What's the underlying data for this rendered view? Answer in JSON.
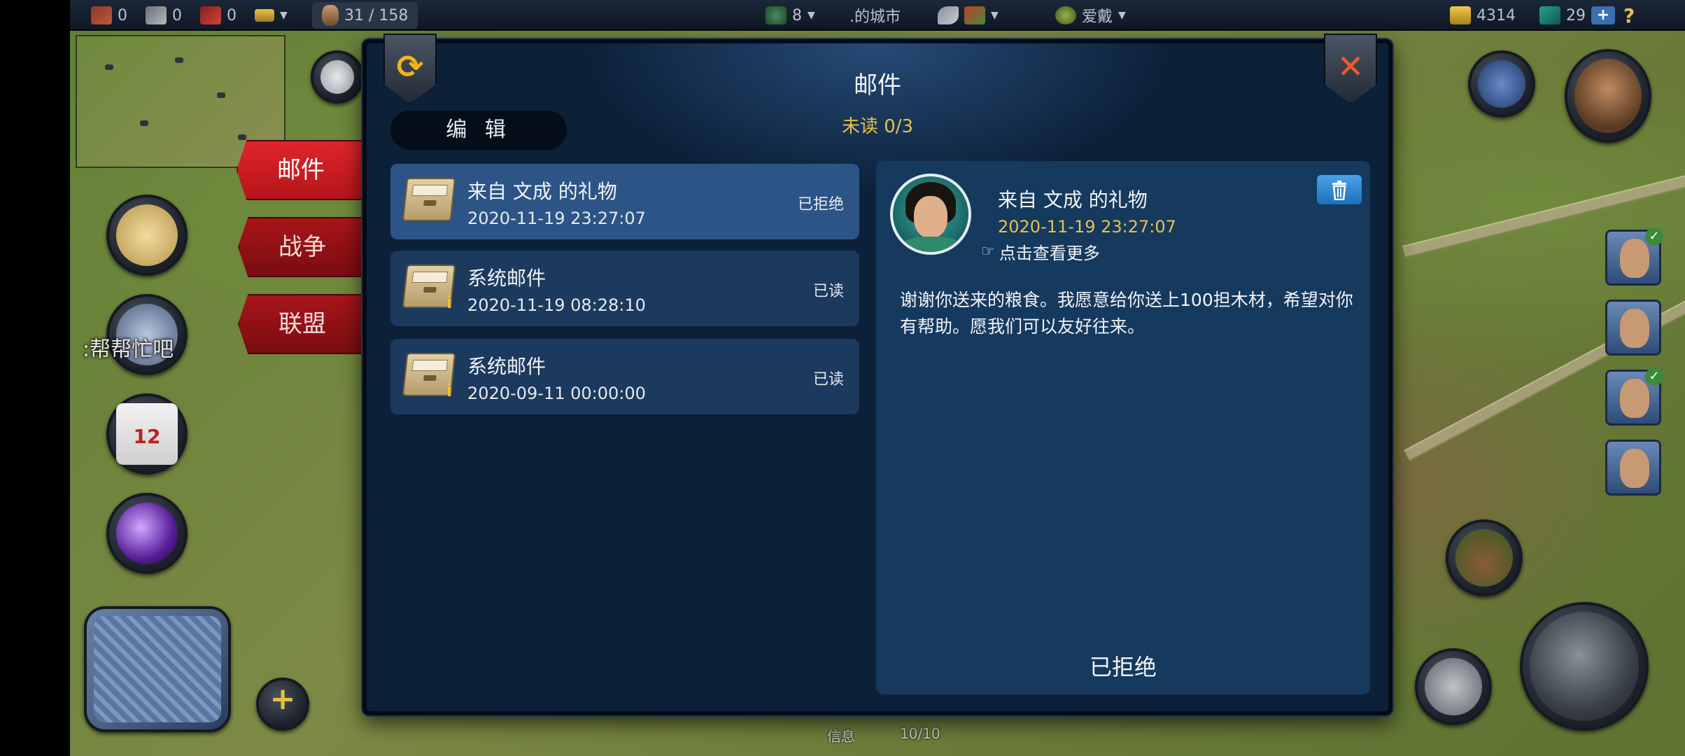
{
  "topbar": {
    "wood": "0",
    "stone": "0",
    "brick": "0",
    "population": "31 / 158",
    "herb_count": "8",
    "city_name": ".的城市",
    "ruler_name": "爱戴",
    "gold": "4314",
    "gems": "29",
    "plus": "+",
    "help": "?"
  },
  "left_hud": {
    "help_label": ":帮帮忙吧",
    "calendar_day": "12",
    "add": "+"
  },
  "side_tabs": [
    {
      "label": "邮件",
      "active": true
    },
    {
      "label": "战争",
      "active": false
    },
    {
      "label": "联盟",
      "active": false
    }
  ],
  "dialog": {
    "title": "邮件",
    "unread": "未读 0/3",
    "edit_label": "编 辑",
    "mails": [
      {
        "title": "来自 文成 的礼物",
        "date": "2020-11-19 23:27:07",
        "status": "已拒绝",
        "selected": true,
        "info": ""
      },
      {
        "title": "系统邮件",
        "date": "2020-11-19 08:28:10",
        "status": "已读",
        "selected": false,
        "info": "i"
      },
      {
        "title": "系统邮件",
        "date": "2020-09-11 00:00:00",
        "status": "已读",
        "selected": false,
        "info": "i"
      }
    ],
    "detail": {
      "title": "来自 文成 的礼物",
      "date": "2020-11-19 23:27:07",
      "more": "点击查看更多",
      "body": "谢谢你送来的粮食。我愿意给你送上100担木材，希望对你有帮助。愿我们可以友好往来。",
      "status": "已拒绝"
    }
  },
  "bottom": {
    "info_label": "信息",
    "capacity": "10/10"
  },
  "icons": {
    "refresh": "refresh-icon",
    "close": "close-icon",
    "delete": "trash-icon"
  },
  "colors": {
    "dialog_bg": "#0c2038",
    "item_bg": "#1b3a5e",
    "item_selected": "#2c5486",
    "accent_gold": "#e6c24a",
    "tab_red": "#e0242a"
  }
}
